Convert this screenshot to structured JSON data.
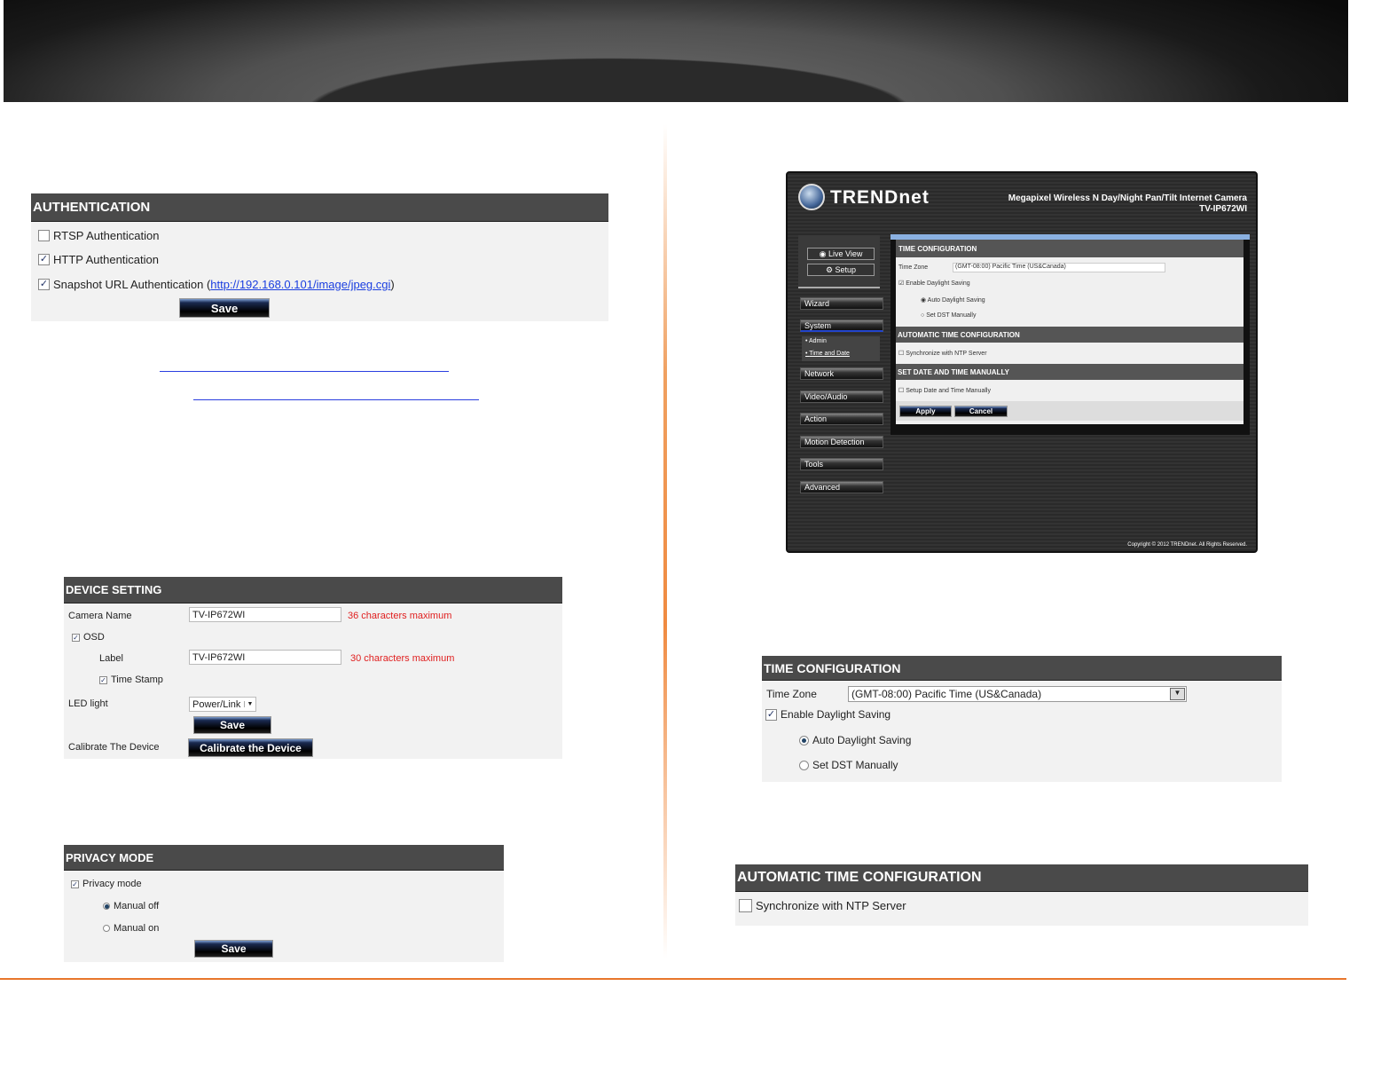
{
  "authentication": {
    "title": "AUTHENTICATION",
    "rtsp": "RTSP Authentication",
    "http": "HTTP Authentication",
    "snapshot": "Snapshot URL Authentication (",
    "snapshot_url": "http://192.168.0.101/image/jpeg.cgi",
    "snapshot_close": ")",
    "save": "Save",
    "rtsp_checked": false,
    "http_checked": true,
    "snapshot_checked": true
  },
  "device": {
    "title": "DEVICE SETTING",
    "camera_name_label": "Camera Name",
    "camera_name": "TV-IP672WI",
    "camera_name_hint": "36 characters maximum",
    "osd": "OSD",
    "label_label": "Label",
    "label_value": "TV-IP672WI",
    "label_hint": "30 characters maximum",
    "timestamp": "Time Stamp",
    "led_label": "LED light",
    "led_value": "Power/Link",
    "save": "Save",
    "calibrate_label": "Calibrate The Device",
    "calibrate_button": "Calibrate the Device"
  },
  "privacy": {
    "title": "PRIVACY MODE",
    "privacy_mode": "Privacy mode",
    "manual_off": "Manual off",
    "manual_on": "Manual on",
    "save": "Save"
  },
  "camera_ui": {
    "brand": "TRENDnet",
    "product": "Megapixel Wireless N Day/Night Pan/Tilt Internet Camera",
    "model": "TV-IP672WI",
    "live_view": "Live View",
    "setup": "Setup",
    "nav": [
      "Wizard",
      "System",
      "Network",
      "Video/Audio",
      "Action",
      "Motion Detection",
      "Tools",
      "Advanced"
    ],
    "sub": [
      "Admin",
      "Time and Date"
    ],
    "time_config": "TIME CONFIGURATION",
    "time_zone_label": "Time Zone",
    "time_zone": "(GMT-08:00) Pacific Time (US&Canada)",
    "enable_dst": "Enable Daylight Saving",
    "auto_dst": "Auto Daylight Saving",
    "set_dst": "Set DST Manually",
    "auto_time": "AUTOMATIC TIME CONFIGURATION",
    "ntp": "Synchronize with NTP Server",
    "manual_time": "SET DATE AND TIME MANUALLY",
    "setup_manual": "Setup Date and Time Manually",
    "apply": "Apply",
    "cancel": "Cancel",
    "copyright": "Copyright © 2012 TRENDnet. All Rights Reserved."
  },
  "time_config": {
    "title": "TIME CONFIGURATION",
    "time_zone_label": "Time Zone",
    "time_zone": "(GMT-08:00) Pacific Time (US&Canada)",
    "enable_dst": "Enable Daylight Saving",
    "auto_dst": "Auto Daylight Saving",
    "set_dst": "Set DST Manually"
  },
  "auto_time": {
    "title": "AUTOMATIC TIME CONFIGURATION",
    "ntp": "Synchronize with NTP Server"
  },
  "colors": {
    "accent": "#e8762c",
    "header": "#4a4a4a",
    "link": "#1a3ee0",
    "hint": "#e02020"
  }
}
